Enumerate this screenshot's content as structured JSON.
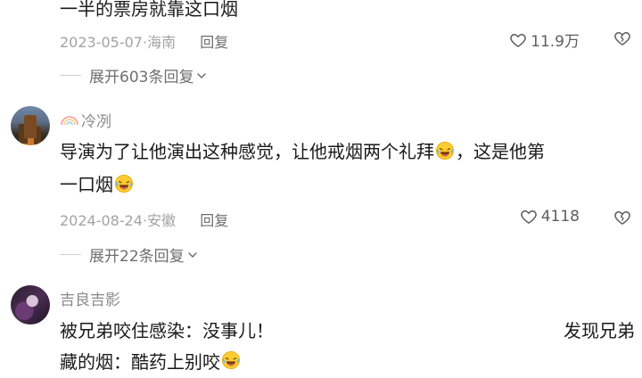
{
  "comments": [
    {
      "text_line1": "一半的票房就靠这口烟",
      "date": "2023-05-07",
      "location": "海南",
      "reply_label": "回复",
      "likes": "11.9万",
      "expand_label": "展开603条回复"
    },
    {
      "username": "冷冽",
      "text_line1_a": "导演为了让他演出这种感觉，让他戒烟两个礼拜",
      "text_line1_b": "，这是他第",
      "text_line2": "一口烟",
      "date": "2024-08-24",
      "location": "安徽",
      "reply_label": "回复",
      "likes": "4118",
      "expand_label": "展开22条回复"
    },
    {
      "username": "吉良吉影",
      "text_line1_a": "被兄弟咬住感染：没事儿！",
      "text_line1_b": "发现兄弟",
      "text_line2": "藏的烟：酷药上别咬"
    }
  ],
  "separator": "·",
  "icons": {
    "like": "heart-outline-icon",
    "dislike": "broken-heart-icon",
    "expand": "chevron-down-icon",
    "emoji": "laughing-tears-emoji",
    "username_badge": "rainbow-icon"
  },
  "colors": {
    "meta_gray": "#a3a3a3",
    "text": "#1a1a1a",
    "username": "#8a8a8a"
  }
}
